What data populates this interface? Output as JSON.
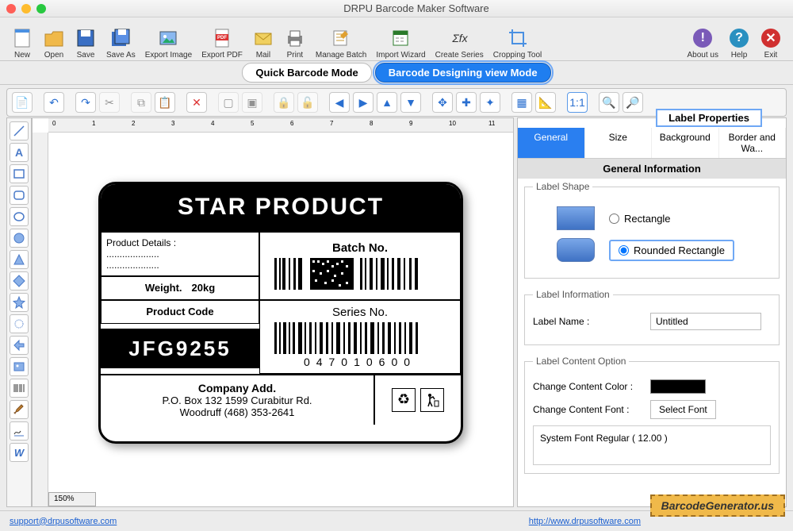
{
  "window": {
    "title": "DRPU Barcode Maker Software"
  },
  "toolbar": [
    {
      "id": "new",
      "label": "New"
    },
    {
      "id": "open",
      "label": "Open"
    },
    {
      "id": "save",
      "label": "Save"
    },
    {
      "id": "saveas",
      "label": "Save As"
    },
    {
      "id": "exportimg",
      "label": "Export Image"
    },
    {
      "id": "exportpdf",
      "label": "Export PDF"
    },
    {
      "id": "mail",
      "label": "Mail"
    },
    {
      "id": "print",
      "label": "Print"
    },
    {
      "id": "managebatch",
      "label": "Manage Batch"
    },
    {
      "id": "importwiz",
      "label": "Import Wizard"
    },
    {
      "id": "createseries",
      "label": "Create Series"
    },
    {
      "id": "crop",
      "label": "Cropping Tool"
    }
  ],
  "toolbar_right": [
    {
      "id": "about",
      "label": "About us"
    },
    {
      "id": "help",
      "label": "Help"
    },
    {
      "id": "exit",
      "label": "Exit"
    }
  ],
  "modes": {
    "quick": "Quick Barcode Mode",
    "design": "Barcode Designing view Mode",
    "active": "design"
  },
  "ruler_marks": [
    "0",
    "1",
    "2",
    "3",
    "4",
    "5",
    "6",
    "7",
    "8",
    "9",
    "10",
    "11"
  ],
  "zoom": "150%",
  "label": {
    "title": "STAR PRODUCT",
    "product_details_label": "Product Details :",
    "dots": "....................",
    "weight_label": "Weight.",
    "weight_value": "20kg",
    "product_code_label": "Product Code",
    "product_code_value": "JFG9255",
    "batch_label": "Batch No.",
    "series_label": "Series No.",
    "series_number": "047010600",
    "company_heading": "Company Add.",
    "company_line1": "P.O. Box 132 1599 Curabitur Rd.",
    "company_line2": "Woodruff (468) 353-2641"
  },
  "props": {
    "panel_title": "Label Properties",
    "tabs": [
      "General",
      "Size",
      "Background",
      "Border and Wa..."
    ],
    "active_tab": "General",
    "section_heading": "General Information",
    "shape_legend": "Label Shape",
    "shape_rect": "Rectangle",
    "shape_round": "Rounded Rectangle",
    "info_legend": "Label Information",
    "label_name_label": "Label Name :",
    "label_name_value": "Untitled",
    "content_legend": "Label Content Option",
    "content_color_label": "Change Content Color :",
    "content_font_label": "Change Content Font :",
    "select_font_btn": "Select Font",
    "font_preview": "System Font Regular ( 12.00 )"
  },
  "footer": {
    "support": "support@drpusoftware.com",
    "url": "http://www.drpusoftware.com",
    "brand": "BarcodeGenerator.us"
  }
}
